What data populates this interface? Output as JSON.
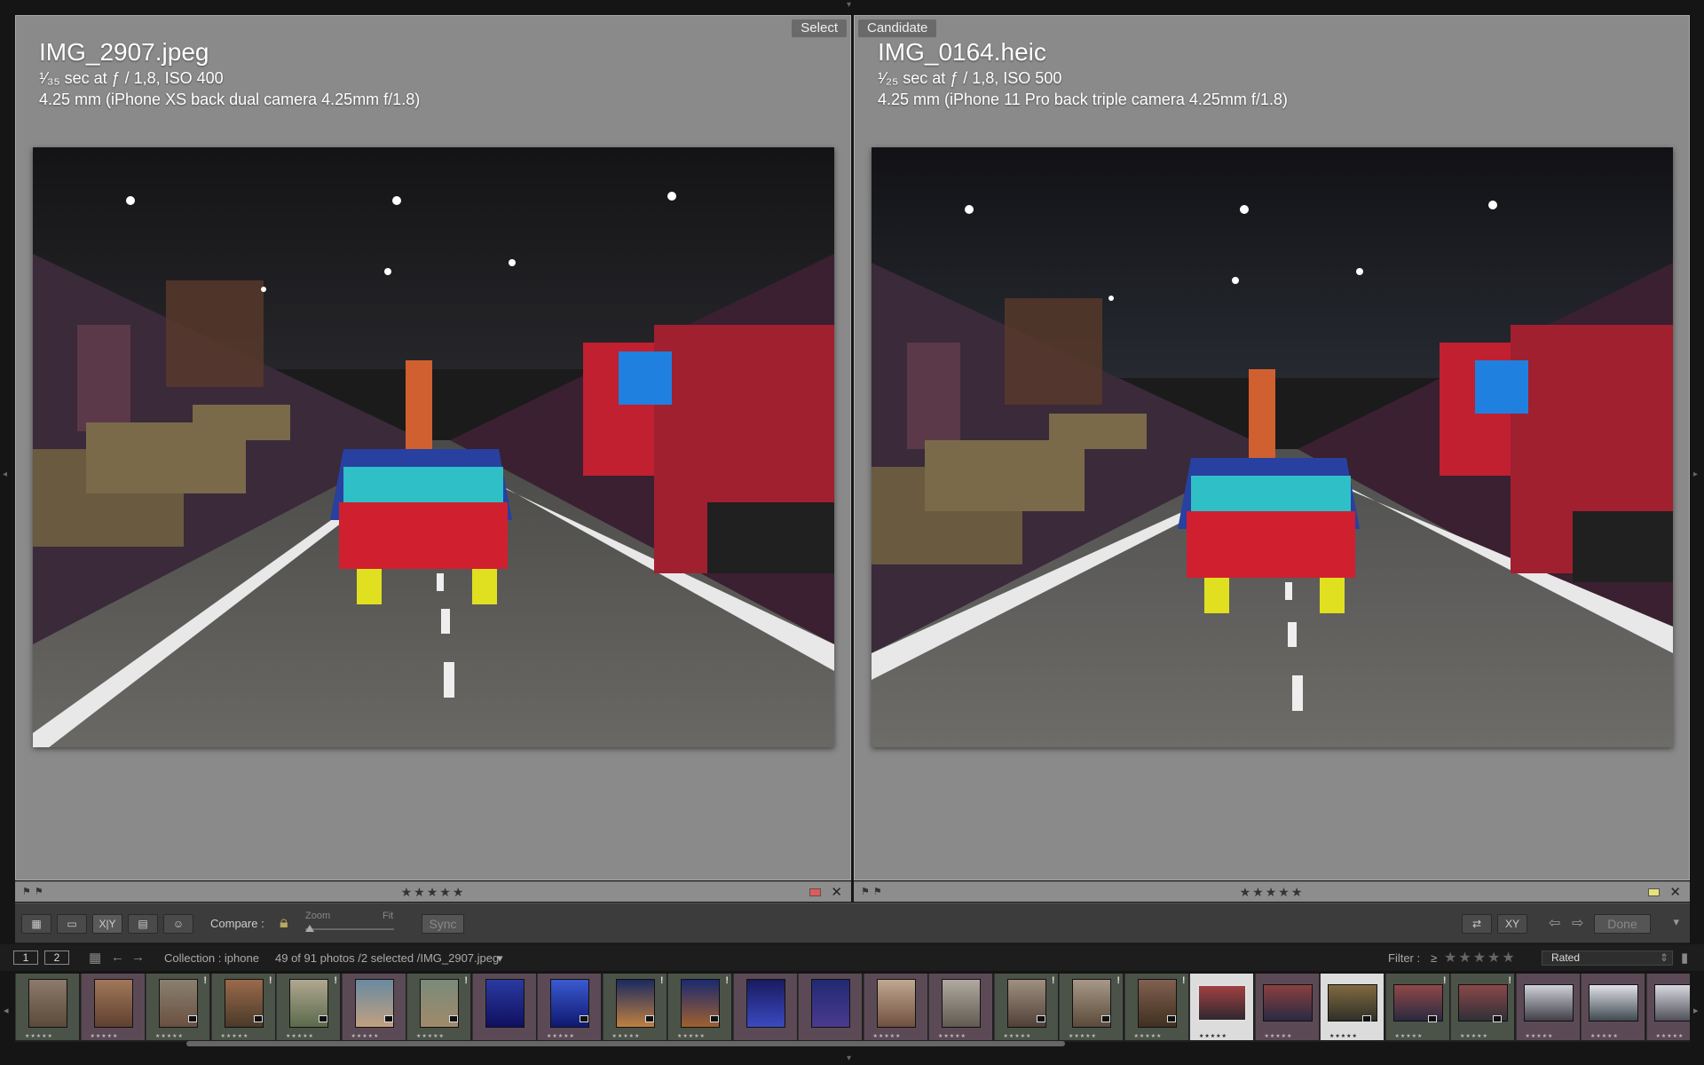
{
  "select": {
    "tag": "Select",
    "filename": "IMG_2907.jpeg",
    "exposure": "¹⁄₃₅ sec at ƒ / 1,8, ISO 400",
    "lens": "4.25 mm (iPhone XS back dual camera 4.25mm f/1.8)",
    "stars": "★★★★★",
    "label_color": "#e05a5a"
  },
  "candidate": {
    "tag": "Candidate",
    "filename": "IMG_0164.heic",
    "exposure": "¹⁄₂₅ sec at ƒ / 1,8, ISO 500",
    "lens": "4.25 mm (iPhone 11 Pro back triple camera 4.25mm f/1.8)",
    "stars": "★★★★★",
    "label_color": "#e8e07a"
  },
  "toolbar": {
    "compare_label": "Compare :",
    "zoom_label": "Zoom",
    "fit_label": "Fit",
    "sync_label": "Sync",
    "done_label": "Done",
    "grid_icon": "grid-view-icon",
    "loupe_icon": "loupe-view-icon",
    "compare_icon": "compare-view-icon",
    "survey_icon": "survey-view-icon",
    "people_icon": "people-view-icon"
  },
  "filmstrip_header": {
    "screen1": "1",
    "screen2": "2",
    "collection": "Collection : iphone",
    "count": "49 of 91 photos /2 selected /IMG_2907.jpeg",
    "filter_label": "Filter :",
    "filter_op": "≥",
    "filter_stars": "★★★★★",
    "rated": "Rated"
  },
  "filmstrip": {
    "cells": [
      {
        "stars": "★★★★★",
        "tone": "greenish",
        "colors": [
          "#8c7a6a",
          "#5a4a3a"
        ],
        "badge": false,
        "warn": false
      },
      {
        "stars": "★★★★★",
        "tone": "pinkish",
        "colors": [
          "#a0785a",
          "#604030"
        ],
        "badge": false,
        "warn": false
      },
      {
        "stars": "★★★★★",
        "tone": "greenish",
        "colors": [
          "#8a8070",
          "#6a5040"
        ],
        "badge": true,
        "warn": true
      },
      {
        "stars": "★★★★★",
        "tone": "greenish",
        "colors": [
          "#9a6a4a",
          "#4a3a2a"
        ],
        "badge": true,
        "warn": true
      },
      {
        "stars": "★★★★★",
        "tone": "greenish",
        "colors": [
          "#b0a890",
          "#5a6a4a"
        ],
        "badge": true,
        "warn": true
      },
      {
        "stars": "★★★★★",
        "tone": "pinkish",
        "colors": [
          "#6a8aa0",
          "#c0a080"
        ],
        "badge": true,
        "warn": false
      },
      {
        "stars": "★★★★★",
        "tone": "greenish",
        "colors": [
          "#7a8a7a",
          "#a08a6a"
        ],
        "badge": true,
        "warn": true
      },
      {
        "stars": "",
        "tone": "pinkish",
        "colors": [
          "#2a3aa0",
          "#101060"
        ],
        "badge": false,
        "warn": false
      },
      {
        "stars": "★★★★★",
        "tone": "pinkish",
        "colors": [
          "#3a5ad0",
          "#101870"
        ],
        "badge": true,
        "warn": false
      },
      {
        "stars": "★★★★★",
        "tone": "greenish",
        "colors": [
          "#1a2a60",
          "#c08040"
        ],
        "badge": true,
        "warn": true
      },
      {
        "stars": "★★★★★",
        "tone": "greenish",
        "colors": [
          "#1a2a70",
          "#a06030"
        ],
        "badge": true,
        "warn": true
      },
      {
        "stars": "",
        "tone": "pinkish",
        "colors": [
          "#1a1a60",
          "#3a4ac0"
        ],
        "badge": false,
        "warn": false
      },
      {
        "stars": "",
        "tone": "pinkish",
        "colors": [
          "#202a70",
          "#4a3a90"
        ],
        "badge": false,
        "warn": false
      },
      {
        "stars": "★★★★★",
        "tone": "pinkish",
        "colors": [
          "#c0a890",
          "#705040"
        ],
        "badge": false,
        "warn": false
      },
      {
        "stars": "★★★★★",
        "tone": "pinkish",
        "colors": [
          "#b0aaa0",
          "#605a50"
        ],
        "badge": false,
        "warn": false
      },
      {
        "stars": "★★★★★",
        "tone": "greenish",
        "colors": [
          "#a09080",
          "#504038"
        ],
        "badge": true,
        "warn": true
      },
      {
        "stars": "★★★★★",
        "tone": "greenish",
        "colors": [
          "#a89888",
          "#5a4a3a"
        ],
        "badge": true,
        "warn": true
      },
      {
        "stars": "★★★★★",
        "tone": "greenish",
        "colors": [
          "#806050",
          "#403020"
        ],
        "badge": true,
        "warn": true
      },
      {
        "stars": "★★★★★",
        "tone": "sel",
        "colors": [
          "#a04040",
          "#302830"
        ],
        "badge": false,
        "warn": false,
        "outline": true
      },
      {
        "stars": "★★★★★",
        "tone": "pinkish",
        "colors": [
          "#8a4040",
          "#2a2a40"
        ],
        "badge": false,
        "warn": false
      },
      {
        "stars": "★★★★★",
        "tone": "sel",
        "colors": [
          "#806a40",
          "#303028"
        ],
        "badge": true,
        "warn": false
      },
      {
        "stars": "★★★★★",
        "tone": "greenish",
        "colors": [
          "#904848",
          "#2a2a40"
        ],
        "badge": true,
        "warn": true
      },
      {
        "stars": "★★★★★",
        "tone": "greenish",
        "colors": [
          "#8a4848",
          "#303038"
        ],
        "badge": true,
        "warn": true
      },
      {
        "stars": "★★★★★",
        "tone": "pinkish",
        "colors": [
          "#d0d0d8",
          "#404048"
        ],
        "badge": false,
        "warn": false
      },
      {
        "stars": "★★★★★",
        "tone": "pinkish",
        "colors": [
          "#e0e0e8",
          "#404a50"
        ],
        "badge": false,
        "warn": false
      },
      {
        "stars": "★★★★★",
        "tone": "pinkish",
        "colors": [
          "#d8d8e0",
          "#50505a"
        ],
        "badge": false,
        "warn": false
      }
    ]
  }
}
